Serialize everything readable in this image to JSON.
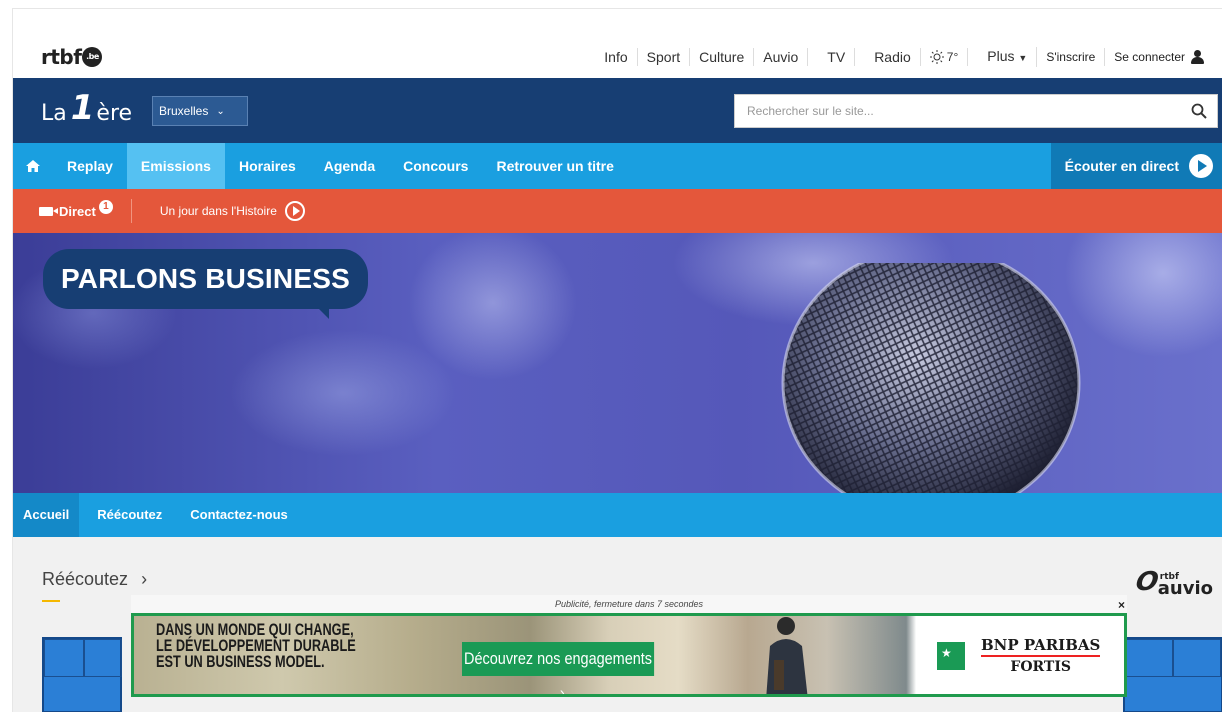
{
  "topbar": {
    "logo": "rtbf",
    "logo_badge": ".be",
    "nav": [
      "Info",
      "Sport",
      "Culture",
      "Auvio"
    ],
    "nav2": [
      "TV",
      "Radio"
    ],
    "weather": "7°",
    "more": "Plus",
    "signup": "S'inscrire",
    "login": "Se connecter"
  },
  "brand": {
    "la": "La",
    "one": "1",
    "ere": "ère",
    "region": "Bruxelles",
    "search_placeholder": "Rechercher sur le site..."
  },
  "mainnav": {
    "items": [
      "Replay",
      "Emissions",
      "Horaires",
      "Agenda",
      "Concours",
      "Retrouver un titre"
    ],
    "active": "Emissions",
    "listen_live": "Écouter en direct"
  },
  "livebar": {
    "direct": "Direct",
    "badge": "1",
    "history": "Un jour dans l'Histoire"
  },
  "hero": {
    "title": "PARLONS BUSINESS"
  },
  "subnav": {
    "items": [
      "Accueil",
      "Réécoutez",
      "Contactez-nous"
    ],
    "active": "Accueil"
  },
  "content": {
    "section_title": "Réécoutez",
    "auvio_brand": "auvio",
    "auvio_small": "rtbf"
  },
  "ad": {
    "caption": "Publicité, fermeture dans 7 secondes",
    "close": "×",
    "headline_lines": [
      "Dans un monde qui change,",
      "le développement durable",
      "est un business model."
    ],
    "cta": "Découvrez nos engagements",
    "brand_name": "BNP PARIBAS",
    "brand_sub": "FORTIS"
  },
  "colors": {
    "brand_blue": "#173e73",
    "nav_blue": "#1a9fe0",
    "live_orange": "#e4573b",
    "ad_green": "#1a9a55"
  }
}
